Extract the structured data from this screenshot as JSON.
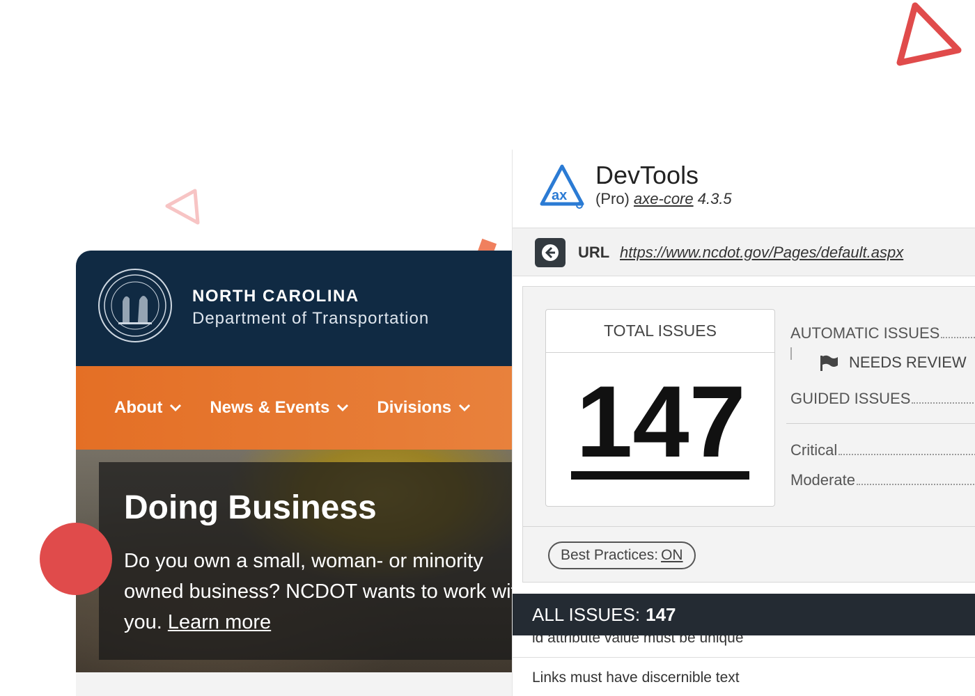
{
  "site": {
    "org_line1": "NORTH CAROLINA",
    "org_line2": "Department of Transportation",
    "nav": [
      {
        "label": "About"
      },
      {
        "label": "News & Events"
      },
      {
        "label": "Divisions"
      }
    ],
    "hero": {
      "title": "Doing Business",
      "text": "Do you own a small, woman- or minority owned business? NCDOT wants to work with you.",
      "link": "Learn more"
    }
  },
  "devtools": {
    "title": "DevTools",
    "edition": "(Pro)",
    "engine": "axe-core",
    "version": "4.3.5",
    "url_label": "URL",
    "url": "https://www.ncdot.gov/Pages/default.aspx",
    "total_label": "TOTAL ISSUES",
    "total_value": "147",
    "stats": {
      "automatic": "AUTOMATIC ISSUES",
      "needs_review": "NEEDS REVIEW",
      "guided": "GUIDED ISSUES",
      "critical": "Critical",
      "moderate": "Moderate"
    },
    "best_practices_label": "Best Practices:",
    "best_practices_value": "ON",
    "all_issues_label": "ALL ISSUES:",
    "all_issues_value": "147",
    "issues": [
      "id attribute value must be unique",
      "Links must have discernible text"
    ]
  },
  "colors": {
    "header_navy": "#102a43",
    "nav_orange": "#e46f25",
    "accent_red": "#e04b4b",
    "axe_blue": "#2b7bd4"
  }
}
